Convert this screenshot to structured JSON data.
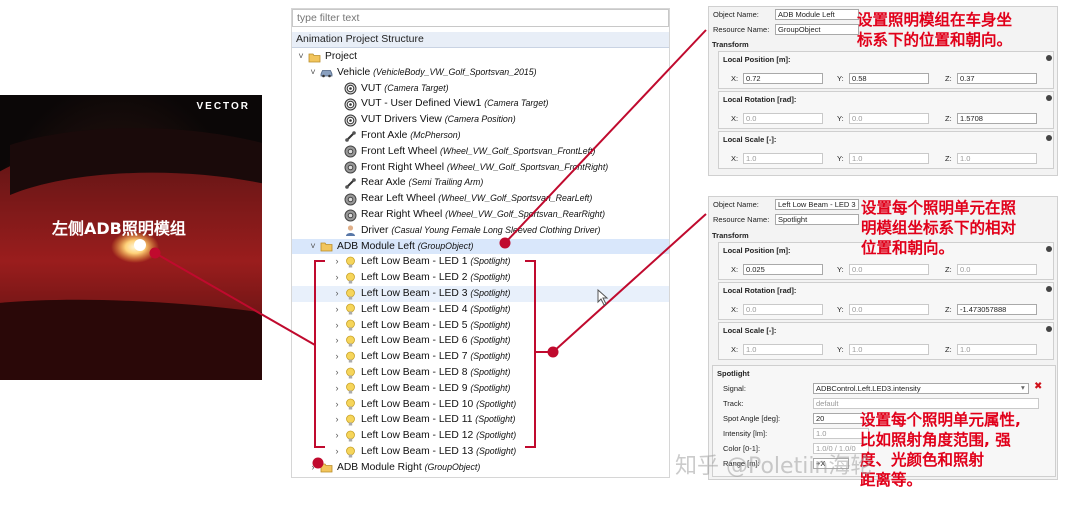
{
  "car": {
    "brand": "VECTOR",
    "label": "左侧ADB照明模组"
  },
  "tree": {
    "filter_placeholder": "type filter text",
    "header": "Animation Project Structure",
    "rows": [
      {
        "name": "Project",
        "sub": ""
      },
      {
        "name": "Vehicle",
        "sub": "(VehicleBody_VW_Golf_Sportsvan_2015)"
      },
      {
        "name": "VUT",
        "sub": "(Camera Target)"
      },
      {
        "name": "VUT - User Defined View1",
        "sub": "(Camera Target)"
      },
      {
        "name": "VUT Drivers View",
        "sub": "(Camera Position)"
      },
      {
        "name": "Front Axle",
        "sub": "(McPherson)"
      },
      {
        "name": "Front Left Wheel",
        "sub": "(Wheel_VW_Golf_Sportsvan_FrontLeft)"
      },
      {
        "name": "Front Right Wheel",
        "sub": "(Wheel_VW_Golf_Sportsvan_FrontRight)"
      },
      {
        "name": "Rear Axle",
        "sub": "(Semi Trailing Arm)"
      },
      {
        "name": "Rear Left Wheel",
        "sub": "(Wheel_VW_Golf_Sportsvan_RearLeft)"
      },
      {
        "name": "Rear Right Wheel",
        "sub": "(Wheel_VW_Golf_Sportsvan_RearRight)"
      },
      {
        "name": "Driver",
        "sub": "(Casual Young Female Long Sleeved Clothing Driver)"
      },
      {
        "name": "ADB Module Left",
        "sub": "(GroupObject)"
      },
      {
        "name": "Left Low Beam - LED 1",
        "sub": "(Spotlight)"
      },
      {
        "name": "Left Low Beam - LED 2",
        "sub": "(Spotlight)"
      },
      {
        "name": "Left Low Beam - LED 3",
        "sub": "(Spotlight)"
      },
      {
        "name": "Left Low Beam - LED 4",
        "sub": "(Spotlight)"
      },
      {
        "name": "Left Low Beam - LED 5",
        "sub": "(Spotlight)"
      },
      {
        "name": "Left Low Beam - LED 6",
        "sub": "(Spotlight)"
      },
      {
        "name": "Left Low Beam - LED 7",
        "sub": "(Spotlight)"
      },
      {
        "name": "Left Low Beam - LED 8",
        "sub": "(Spotlight)"
      },
      {
        "name": "Left Low Beam - LED 9",
        "sub": "(Spotlight)"
      },
      {
        "name": "Left Low Beam - LED 10",
        "sub": "(Spotlight)"
      },
      {
        "name": "Left Low Beam - LED 11",
        "sub": "(Spotlight)"
      },
      {
        "name": "Left Low Beam - LED 12",
        "sub": "(Spotlight)"
      },
      {
        "name": "Left Low Beam - LED 13",
        "sub": "(Spotlight)"
      },
      {
        "name": "ADB Module Right",
        "sub": "(GroupObject)"
      }
    ]
  },
  "panel1": {
    "object_name_label": "Object Name:",
    "object_name": "ADB Module Left",
    "resource_name_label": "Resource Name:",
    "resource_name": "GroupObject",
    "transform": "Transform",
    "pos_label": "Local Position [m]:",
    "pos": [
      "0.72",
      "0.58",
      "0.37"
    ],
    "rot_label": "Local Rotation [rad]:",
    "rot": [
      "0.0",
      "0.0",
      "1.5708"
    ],
    "scale_label": "Local Scale [-]:",
    "scale": [
      "1.0",
      "1.0",
      "1.0"
    ]
  },
  "panel2": {
    "object_name_label": "Object Name:",
    "object_name": "Left Low Beam - LED 3",
    "resource_name_label": "Resource Name:",
    "resource_name": "Spotlight",
    "transform": "Transform",
    "pos_label": "Local Position [m]:",
    "pos": [
      "0.025",
      "0.0",
      "0.0"
    ],
    "rot_label": "Local Rotation [rad]:",
    "rot": [
      "0.0",
      "0.0",
      "-1.473057888"
    ],
    "scale_label": "Local Scale [-]:",
    "scale": [
      "1.0",
      "1.0",
      "1.0"
    ],
    "spotlight": "Spotlight",
    "signal_label": "Signal:",
    "signal": "ADBControl.Left.LED3.intensity",
    "track_label": "Track:",
    "track": "default",
    "spot_angle_label": "Spot Angle [deg]:",
    "spot_angle": "20",
    "intensity_label": "Intensity [lm]:",
    "intensity": "1.0",
    "color_label": "Color [0-1]:",
    "color": "1.0/0 / 1.0/0",
    "range_label": "Range [m]:",
    "range": "+X"
  },
  "axes": {
    "x": "X:",
    "y": "Y:",
    "z": "Z:"
  },
  "notes": {
    "n1": [
      "设置照明模组在车身坐",
      "标系下的位置和朝向。"
    ],
    "n2": [
      "设置每个照明单元在照",
      "明模组坐标系下的相对",
      "位置和朝向。"
    ],
    "n3": [
      "设置每个照明单元属性,",
      "比如照射角度范围, 强",
      "度、光颜色和照射",
      "距离等。"
    ]
  },
  "watermark": "知乎 @Poletiin海轮",
  "colors": {
    "accent": "#c00a2e",
    "note": "#e1001a",
    "selection": "#d9e7fb"
  }
}
